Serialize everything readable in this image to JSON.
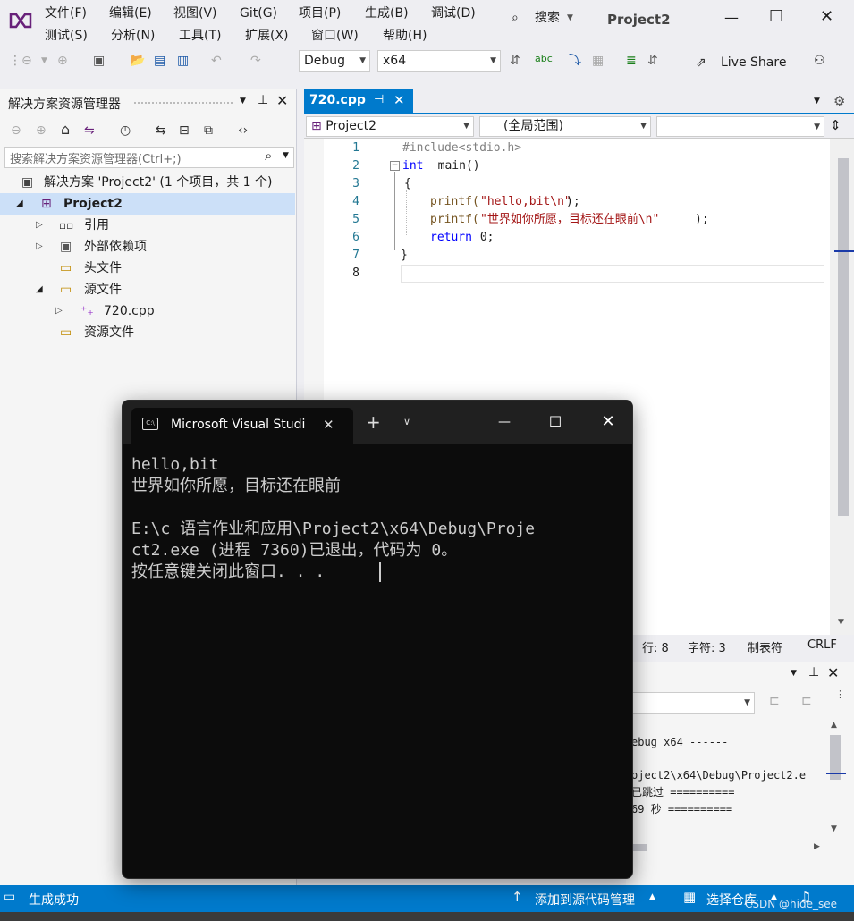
{
  "menu": {
    "row1": [
      "文件(F)",
      "编辑(E)",
      "视图(V)",
      "Git(G)",
      "项目(P)",
      "生成(B)",
      "调试(D)"
    ],
    "row2": [
      "测试(S)",
      "分析(N)",
      "工具(T)",
      "扩展(X)",
      "窗口(W)",
      "帮助(H)"
    ],
    "search_label": "搜索",
    "project_title": "Project2"
  },
  "toolbar": {
    "config": "Debug",
    "platform": "x64",
    "live_share": "Live Share"
  },
  "solution_explorer": {
    "title": "解决方案资源管理器",
    "search_placeholder": "搜索解决方案资源管理器(Ctrl+;)",
    "tree": [
      {
        "label": "解决方案 'Project2' (1 个项目，共 1 个)",
        "icon": "solution-icon"
      },
      {
        "label": "Project2",
        "icon": "project-icon",
        "bold": true,
        "selected": true
      },
      {
        "label": "引用",
        "icon": "references-icon"
      },
      {
        "label": "外部依赖项",
        "icon": "external-deps-icon"
      },
      {
        "label": "头文件",
        "icon": "folder-filter-icon"
      },
      {
        "label": "源文件",
        "icon": "folder-filter-icon"
      },
      {
        "label": "720.cpp",
        "icon": "cpp-file-icon"
      },
      {
        "label": "资源文件",
        "icon": "folder-filter-icon"
      }
    ]
  },
  "editor": {
    "tab": "720.cpp",
    "nav_project": "Project2",
    "nav_scope": "(全局范围)",
    "line_numbers": [
      "1",
      "2",
      "3",
      "4",
      "5",
      "6",
      "7",
      "8"
    ],
    "code": {
      "l1": "#include<stdio.h>",
      "l2_kw": "int",
      "l2_rest": "  main()",
      "l3": "{",
      "l4_fn": "printf(",
      "l4_str": "\"hello,bit\\n\"",
      "l4_end": ");",
      "l5_fn": "printf(",
      "l5_str": "\"世界如你所愿，目标还在眼前\\n\"",
      "l5_end": ");",
      "l6_kw": "return",
      "l6_rest": " 0;",
      "l7": "}"
    },
    "status": {
      "line": "行: 8",
      "char": "字符: 3",
      "tab": "制表符",
      "eol": "CRLF"
    }
  },
  "output_panel": {
    "lines": [
      "ebug x64 ------",
      "oject2\\x64\\Debug\\Project2.e",
      "已跳过 ==========",
      "69 秒 =========="
    ]
  },
  "console": {
    "title": "Microsoft Visual Studi",
    "lines": [
      "hello,bit",
      "世界如你所愿，目标还在眼前",
      "",
      "E:\\c 语言作业和应用\\Project2\\x64\\Debug\\Proje",
      "ct2.exe (进程 7360)已退出，代码为 0。",
      "按任意键关闭此窗口. . ."
    ]
  },
  "statusbar": {
    "left": "生成成功",
    "source_control": "添加到源代码管理",
    "repo": "选择仓库",
    "watermark": "CSDN @hide_see"
  }
}
